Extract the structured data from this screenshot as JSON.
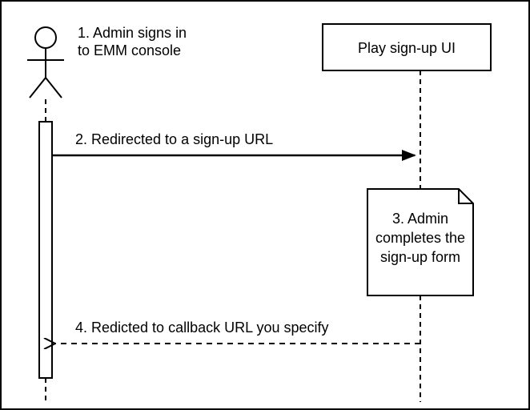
{
  "step1_line1": "1. Admin signs in",
  "step1_line2": "to EMM console",
  "participant_play": "Play sign-up UI",
  "step2": "2. Redirected to a sign-up URL",
  "step3_line1": "3. Admin",
  "step3_line2": "completes the",
  "step3_line3": "sign-up form",
  "step4": "4. Redicted to callback URL you specify"
}
